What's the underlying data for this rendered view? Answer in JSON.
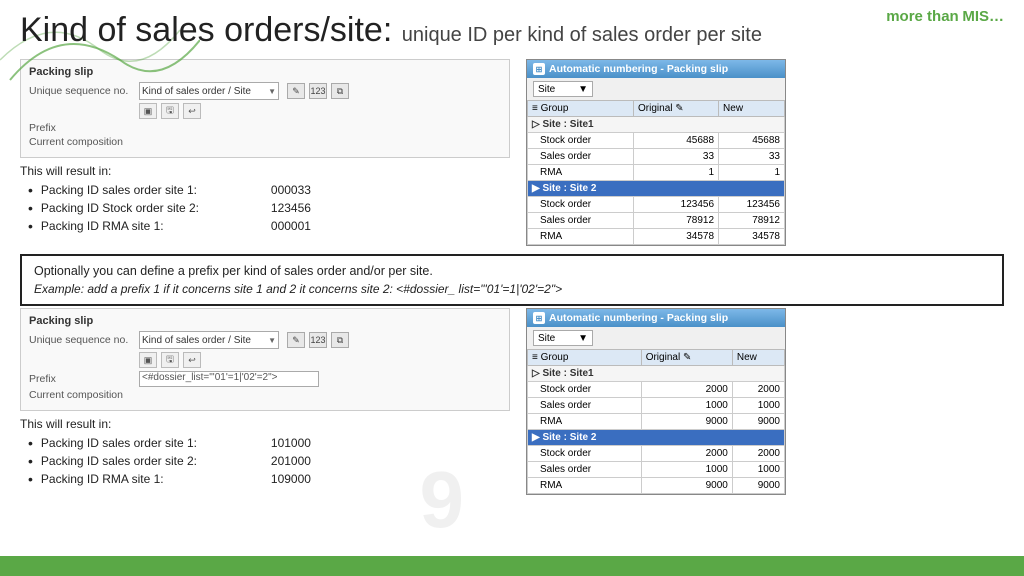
{
  "branding": {
    "tagline": "more than",
    "brand": "MIS…"
  },
  "header": {
    "title_main": "Kind of sales orders/site:",
    "title_sub": " unique ID per kind of sales order per site"
  },
  "section1": {
    "packing_slip": {
      "title": "Packing slip",
      "unique_seq_label": "Unique sequence no.",
      "select_value": "Kind of sales order / Site",
      "prefix_label": "Prefix",
      "composition_label": "Current composition",
      "edit_icon": "✎",
      "num_icon": "123",
      "copy_icon": "⧉"
    },
    "result_intro": "This will result in:",
    "results": [
      {
        "label": "Packing ID sales order site 1:",
        "value": "000033"
      },
      {
        "label": "Packing ID Stock order site 2:",
        "value": "123456"
      },
      {
        "label": "Packing ID RMA site 1:",
        "value": "000001"
      }
    ]
  },
  "auto_window1": {
    "title": "Automatic numbering - Packing slip",
    "site_label": "Site",
    "columns": [
      "Group",
      "Original",
      "New"
    ],
    "site1": {
      "label": "Site : Site1",
      "rows": [
        {
          "name": "Stock order",
          "original": "45688",
          "new": "45688"
        },
        {
          "name": "Sales order",
          "original": "33",
          "new": "33"
        },
        {
          "name": "RMA",
          "original": "1",
          "new": "1"
        }
      ]
    },
    "site2": {
      "label": "Site : Site 2",
      "rows": [
        {
          "name": "Stock order",
          "original": "123456",
          "new": "123456"
        },
        {
          "name": "Sales order",
          "original": "78912",
          "new": "78912"
        },
        {
          "name": "RMA",
          "original": "34578",
          "new": "34578"
        }
      ]
    }
  },
  "highlight": {
    "text": "Optionally you can define a prefix per kind of sales order and/or per site.",
    "italic": "Example: add a prefix 1 if it concerns site 1 and 2 it concerns site 2: <#dossier_ list=\"'01'=1|'02'=2\">"
  },
  "section2": {
    "packing_slip": {
      "title": "Packing slip",
      "unique_seq_label": "Unique sequence no.",
      "select_value": "Kind of sales order / Site",
      "prefix_label": "Prefix",
      "prefix_value": "<#dossier_list=\"'01'=1|'02'=2\">",
      "composition_label": "Current composition"
    },
    "result_intro": "This will result in:",
    "results": [
      {
        "label": "Packing ID sales order site 1:",
        "value": "101000"
      },
      {
        "label": "Packing ID sales order site 2:",
        "value": "201000"
      },
      {
        "label": "Packing ID RMA site 1:",
        "value": "109000"
      }
    ]
  },
  "auto_window2": {
    "title": "Automatic numbering - Packing slip",
    "site_label": "Site",
    "columns": [
      "Group",
      "Original",
      "New"
    ],
    "site1": {
      "label": "Site : Site1",
      "rows": [
        {
          "name": "Stock order",
          "original": "2000",
          "new": "2000"
        },
        {
          "name": "Sales order",
          "original": "1000",
          "new": "1000"
        },
        {
          "name": "RMA",
          "original": "9000",
          "new": "9000"
        }
      ]
    },
    "site2": {
      "label": "Site : Site 2",
      "rows": [
        {
          "name": "Stock order",
          "original": "2000",
          "new": "2000"
        },
        {
          "name": "Sales order",
          "original": "1000",
          "new": "1000"
        },
        {
          "name": "RMA",
          "original": "9000",
          "new": "9000"
        }
      ]
    }
  },
  "page_number": "9"
}
